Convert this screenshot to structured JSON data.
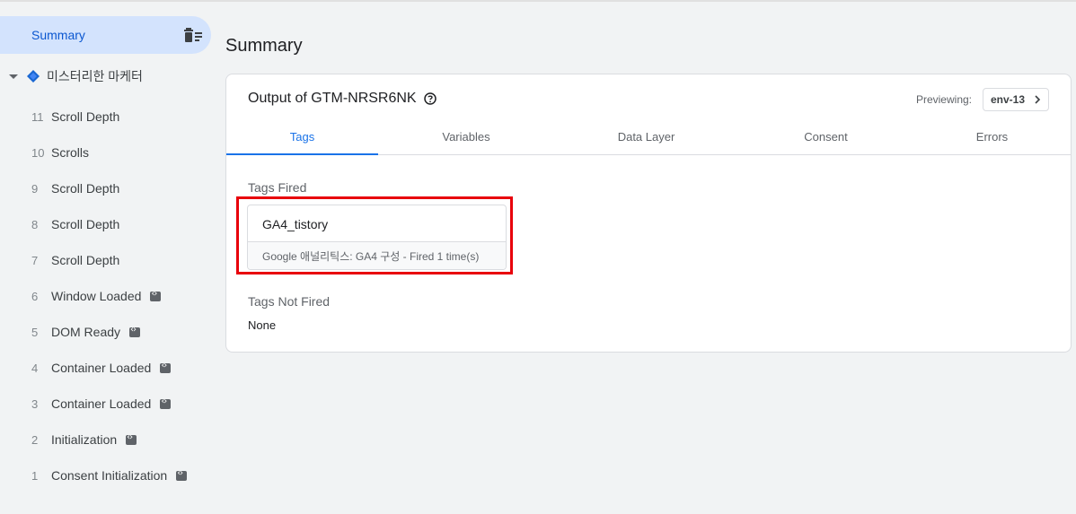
{
  "sidebar": {
    "summary_label": "Summary",
    "container_name": "미스터리한 마케터",
    "events": [
      {
        "num": "11",
        "name": "Scroll Depth",
        "code": false
      },
      {
        "num": "10",
        "name": "Scrolls",
        "code": false
      },
      {
        "num": "9",
        "name": "Scroll Depth",
        "code": false
      },
      {
        "num": "8",
        "name": "Scroll Depth",
        "code": false
      },
      {
        "num": "7",
        "name": "Scroll Depth",
        "code": false
      },
      {
        "num": "6",
        "name": "Window Loaded",
        "code": true
      },
      {
        "num": "5",
        "name": "DOM Ready",
        "code": true
      },
      {
        "num": "4",
        "name": "Container Loaded",
        "code": true
      },
      {
        "num": "3",
        "name": "Container Loaded",
        "code": true
      },
      {
        "num": "2",
        "name": "Initialization",
        "code": true
      },
      {
        "num": "1",
        "name": "Consent Initialization",
        "code": true
      }
    ]
  },
  "main": {
    "title": "Summary",
    "card": {
      "title": "Output of GTM-NRSR6NK",
      "previewing_label": "Previewing:",
      "env": "env-13",
      "tabs": [
        {
          "label": "Tags",
          "active": true
        },
        {
          "label": "Variables",
          "active": false
        },
        {
          "label": "Data Layer",
          "active": false
        },
        {
          "label": "Consent",
          "active": false
        },
        {
          "label": "Errors",
          "active": false
        }
      ],
      "tags_fired_label": "Tags Fired",
      "fired_tag": {
        "name": "GA4_tistory",
        "detail": "Google 애널리틱스: GA4 구성 - Fired 1 time(s)"
      },
      "tags_not_fired_label": "Tags Not Fired",
      "not_fired_value": "None"
    }
  },
  "colors": {
    "accent": "#1a73e8",
    "summary_bg": "#d3e3fd",
    "highlight": "#e8000b",
    "container_icon": "#1967d2"
  },
  "icons": [
    "trash-list-icon",
    "caret-down-icon",
    "container-diamond-icon",
    "code-icon",
    "help-circle-icon",
    "chevron-right-icon"
  ]
}
